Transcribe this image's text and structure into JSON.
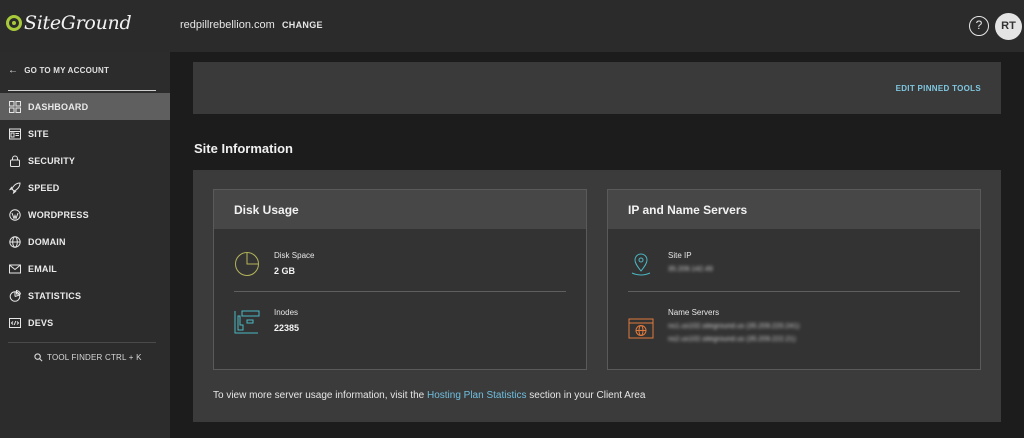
{
  "header": {
    "logo_text": "SiteGround",
    "domain": "redpillrebellion.com",
    "change_label": "CHANGE",
    "help_icon": "?",
    "avatar_initials": "RT"
  },
  "sidebar": {
    "back_label": "GO TO MY ACCOUNT",
    "items": [
      {
        "label": "DASHBOARD",
        "icon": "dashboard-icon"
      },
      {
        "label": "SITE",
        "icon": "site-icon"
      },
      {
        "label": "SECURITY",
        "icon": "lock-icon"
      },
      {
        "label": "SPEED",
        "icon": "rocket-icon"
      },
      {
        "label": "WORDPRESS",
        "icon": "wordpress-icon"
      },
      {
        "label": "DOMAIN",
        "icon": "globe-icon"
      },
      {
        "label": "EMAIL",
        "icon": "mail-icon"
      },
      {
        "label": "STATISTICS",
        "icon": "pie-chart-icon"
      },
      {
        "label": "DEVS",
        "icon": "code-icon"
      }
    ],
    "tool_finder": "TOOL FINDER CTRL + K"
  },
  "pinned_tools": {
    "edit_label": "EDIT PINNED TOOLS"
  },
  "site_information": {
    "title": "Site Information",
    "disk_usage": {
      "title": "Disk Usage",
      "disk_space_label": "Disk Space",
      "disk_space_value": "2 GB",
      "inodes_label": "Inodes",
      "inodes_value": "22385"
    },
    "ip_name_servers": {
      "title": "IP and Name Servers",
      "site_ip_label": "Site IP",
      "site_ip_value": "35.209.142.49",
      "name_servers_label": "Name Servers",
      "name_server_1": "ns1.us102.siteground.us (35.209.220.241)",
      "name_server_2": "ns2.us102.siteground.us (35.209.222.21)"
    },
    "footer": {
      "prefix": "To view more server usage information, visit the ",
      "link": "Hosting Plan Statistics",
      "suffix": " section in your Client Area"
    }
  },
  "colors": {
    "accent_link": "#6fbfe0",
    "brand_green": "#a8c93a",
    "active_nav": "#5f5f5f"
  }
}
